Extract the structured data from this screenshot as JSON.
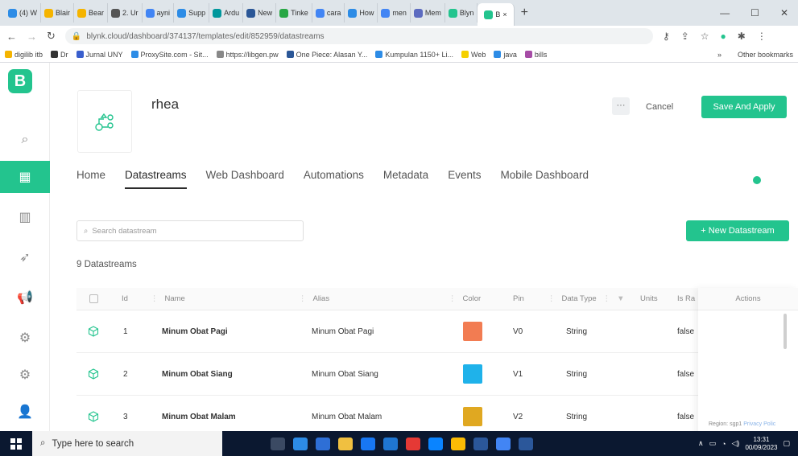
{
  "browser": {
    "tabs": [
      {
        "label": "(4) W",
        "color": "#2d8ce6"
      },
      {
        "label": "Blair",
        "color": "#f5b400"
      },
      {
        "label": "Bear",
        "color": "#f5b400"
      },
      {
        "label": "2. Ur",
        "color": "#555555"
      },
      {
        "label": "ayni",
        "color": "#4285f4"
      },
      {
        "label": "Supp",
        "color": "#2d8ce6"
      },
      {
        "label": "Ardu",
        "color": "#00979c"
      },
      {
        "label": "New",
        "color": "#2b5797"
      },
      {
        "label": "Tinke",
        "color": "#28a745"
      },
      {
        "label": "cara",
        "color": "#4285f4"
      },
      {
        "label": "How",
        "color": "#2d8ce6"
      },
      {
        "label": "men",
        "color": "#4285f4"
      },
      {
        "label": "Mem",
        "color": "#5c6bc0"
      },
      {
        "label": "Blyn",
        "color": "#23c48e"
      }
    ],
    "active_tab": "B",
    "active_tab_close": "×",
    "new_tab": "+",
    "url": "blynk.cloud/dashboard/374137/templates/edit/852959/datastreams",
    "bookmarks": [
      {
        "label": "digilib itb",
        "color": "#f5b400"
      },
      {
        "label": "Dr",
        "color": "#333333"
      },
      {
        "label": "Jurnal UNY",
        "color": "#3a5fcd"
      },
      {
        "label": "ProxySite.com - Sit...",
        "color": "#2d8ce6"
      },
      {
        "label": "https://libgen.pw",
        "color": "#888888"
      },
      {
        "label": "One Piece: Alasan Y...",
        "color": "#2b5797"
      },
      {
        "label": "Kumpulan 1150+ Li...",
        "color": "#2d8ce6"
      },
      {
        "label": "Web",
        "color": "#f5d000"
      },
      {
        "label": "java",
        "color": "#2d8ce6"
      },
      {
        "label": "bills",
        "color": "#a64ca6"
      }
    ],
    "other_bookmarks": "Other bookmarks"
  },
  "app": {
    "logo": "B",
    "template_name": "rhea",
    "more_label": "···",
    "cancel_label": "Cancel",
    "save_label": "Save And Apply",
    "tabs": [
      "Home",
      "Datastreams",
      "Web Dashboard",
      "Automations",
      "Metadata",
      "Events",
      "Mobile Dashboard"
    ],
    "active_tab_index": 1,
    "search_placeholder": "Search datastream",
    "new_datastream_label": "+ New Datastream",
    "datastream_count": "9 Datastreams",
    "columns": {
      "id": "Id",
      "name": "Name",
      "alias": "Alias",
      "color": "Color",
      "pin": "Pin",
      "data_type": "Data Type",
      "units": "Units",
      "is_raw": "Is Ra",
      "actions": "Actions"
    },
    "rows": [
      {
        "id": "1",
        "name": "Minum Obat Pagi",
        "alias": "Minum Obat Pagi",
        "color": "#f27c52",
        "pin": "V0",
        "data_type": "String",
        "is_raw": "false"
      },
      {
        "id": "2",
        "name": "Minum Obat Siang",
        "alias": "Minum Obat Siang",
        "color": "#1fb2ea",
        "pin": "V1",
        "data_type": "String",
        "is_raw": "false"
      },
      {
        "id": "3",
        "name": "Minum Obat Malam",
        "alias": "Minum Obat Malam",
        "color": "#e0a821",
        "pin": "V2",
        "data_type": "String",
        "is_raw": "false"
      }
    ],
    "region_label": "Region: sgp1",
    "privacy_label": "Privacy Polic",
    "accent_color": "#23c48e"
  },
  "taskbar": {
    "search_placeholder": "Type here to search",
    "time": "13:31",
    "date": "00/09/2023"
  }
}
